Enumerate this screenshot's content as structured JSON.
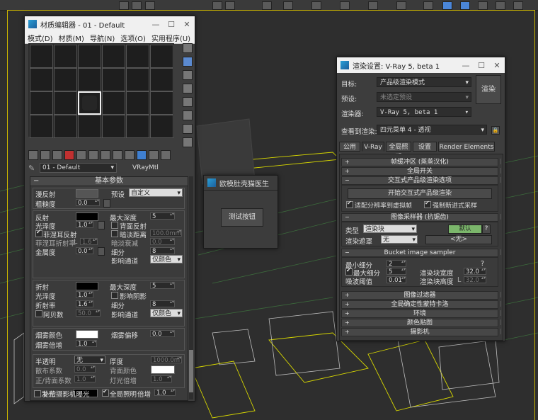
{
  "material_editor": {
    "title": "材质编辑器 - 01 - Default",
    "menu": [
      "模式(D)",
      "材质(M)",
      "导航(N)",
      "选项(O)",
      "实用程序(U)"
    ],
    "material_name": "01 - Default",
    "material_type": "VRayMtl",
    "rollout_title": "基本参数",
    "diffuse": {
      "label": "漫反射",
      "roughness_label": "粗糙度",
      "roughness": "0.0",
      "preset_label": "预设",
      "preset_value": "自定义"
    },
    "reflect": {
      "label": "反射",
      "max_depth_label": "最大深度",
      "max_depth": "5",
      "gloss_label": "光泽度",
      "gloss": "1.0",
      "back_reflect_label": "背面反射",
      "fresnel_label": "菲涅耳反射",
      "dim_distance_label": "暗淡距离",
      "dim_distance": "100.0mm",
      "fresnel_ior_label": "菲涅耳折射率",
      "fresnel_ior_L": "L",
      "fresnel_ior": "1.6",
      "dim_falloff_label": "暗淡衰减",
      "dim_falloff": "0.0",
      "metalness_label": "金属度",
      "metalness": "0.0",
      "subdivs_label": "细分",
      "subdivs": "8",
      "affect_channels_label": "影响通道",
      "affect_channels": "仅颜色"
    },
    "refract": {
      "label": "折射",
      "max_depth_label": "最大深度",
      "max_depth": "5",
      "gloss_label": "光泽度",
      "gloss": "1.0",
      "affect_shadows_label": "影响阴影",
      "ior_label": "折射率",
      "ior": "1.6",
      "subdivs_label": "细分",
      "subdivs": "8",
      "abbe_label": "阿贝数",
      "abbe": "50.0",
      "affect_channels_label": "影响通道",
      "affect_channels": "仅颜色"
    },
    "fog": {
      "color_label": "烟雾颜色",
      "bias_label": "烟雾偏移",
      "bias": "0.0",
      "multiplier_label": "烟雾倍增",
      "multiplier": "1.0"
    },
    "translucency": {
      "label": "半透明",
      "type": "无",
      "thickness_label": "厚度",
      "thickness": "1000.0m",
      "scatter_label": "散布系数",
      "scatter": "0.0",
      "back_color_label": "背面颜色",
      "fb_label": "正/背面系数",
      "fb": "1.0",
      "light_mult_label": "灯光倍增",
      "light_mult": "1.0"
    },
    "self_illum": {
      "label": "自发光",
      "gi_label": "全局照明",
      "mult_label": "倍增",
      "mult": "1.0",
      "compensate_label": "补偿摄影机曝光"
    }
  },
  "test_dialog": {
    "title": "欧模肚壳猫医生",
    "button": "测试按钮"
  },
  "render_setup": {
    "title": "渲染设置: V-Ray 5, beta 1",
    "target_label": "目标:",
    "target": "产品级渲染模式",
    "preset_label": "预设:",
    "preset": "未选定预设",
    "renderer_label": "渲染器:",
    "renderer": "V-Ray 5, beta 1",
    "render_button": "渲染",
    "view_label": "查看到渲染:",
    "view": "四元菜单 4 - 透视",
    "tabs": [
      "公用",
      "V-Ray",
      "全局照明",
      "设置",
      "Render Elements"
    ],
    "active_tab": "V-Ray",
    "rollouts_top": [
      "帧缓冲区 (蒸蒸汉化)",
      "全局开关"
    ],
    "ipr": {
      "title": "交互式产品级渲染选项",
      "start_button": "开始交互式产品级渲染",
      "fit_label": "适配分辨率到虚拟帧",
      "force_label": "强制新进式采样"
    },
    "sampler": {
      "title": "图像采样器 (抗锯齿)",
      "type_label": "类型",
      "type": "渲染块",
      "default_button": "默认",
      "help": "?",
      "mask_label": "渲染遮罩",
      "mask": "无",
      "mask_value": "<无>"
    },
    "bucket": {
      "title": "Bucket image sampler",
      "min_subdivs_label": "最小细分",
      "min_subdivs": "2",
      "help": "?",
      "max_subdivs_label": "最大细分",
      "max_subdivs": "5",
      "bucket_width_label": "渲染块宽度",
      "bucket_width": "32.0",
      "noise_label": "噪波阈值",
      "noise": "0.01",
      "bucket_height_label": "渲染块高度",
      "bucket_height_L": "L",
      "bucket_height": "32.0"
    },
    "rollouts_bottom": [
      "图像过滤器",
      "全局确定性蒙特卡洛",
      "环境",
      "颜色贴图",
      "摄影机"
    ]
  },
  "colors": {
    "viewport_frame": "#c9b400",
    "active_highlight": "#4a86d9",
    "default_button": "#7bb66b"
  }
}
